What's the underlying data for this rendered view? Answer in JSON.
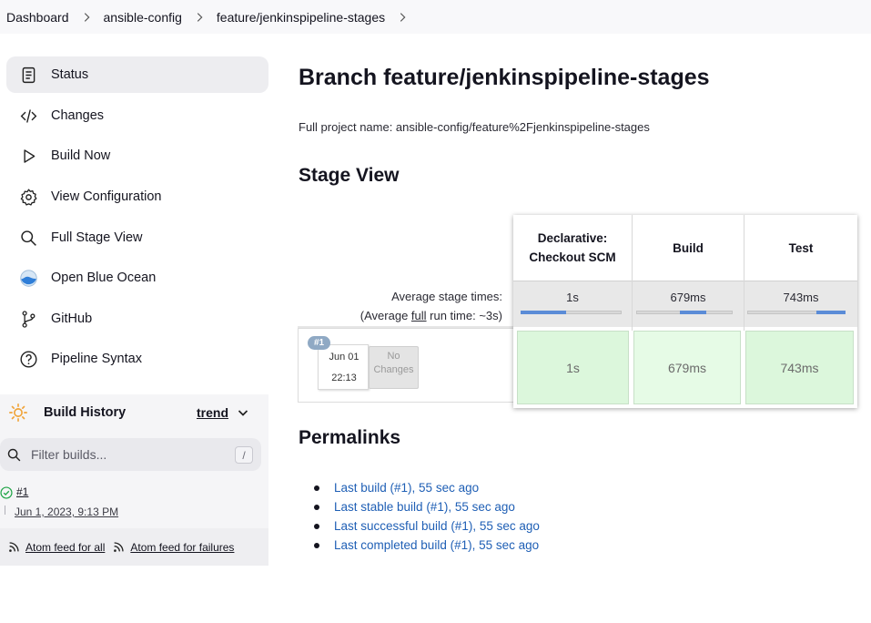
{
  "breadcrumb": [
    "Dashboard",
    "ansible-config",
    "feature/jenkinspipeline-stages"
  ],
  "sidebar": {
    "tasks": [
      {
        "label": "Status",
        "icon": "document-icon",
        "active": true
      },
      {
        "label": "Changes",
        "icon": "code-icon",
        "active": false
      },
      {
        "label": "Build Now",
        "icon": "play-icon",
        "active": false
      },
      {
        "label": "View Configuration",
        "icon": "gear-icon",
        "active": false
      },
      {
        "label": "Full Stage View",
        "icon": "search-icon",
        "active": false
      },
      {
        "label": "Open Blue Ocean",
        "icon": "blue-ocean-icon",
        "active": false
      },
      {
        "label": "GitHub",
        "icon": "git-branch-icon",
        "active": false
      },
      {
        "label": "Pipeline Syntax",
        "icon": "help-icon",
        "active": false
      }
    ]
  },
  "build_history": {
    "title": "Build History",
    "trend_label": "trend",
    "filter_placeholder": "Filter builds...",
    "filter_shortcut": "/",
    "builds": [
      {
        "number": "#1",
        "date": "Jun 1, 2023, 9:13 PM",
        "status": "success"
      }
    ],
    "feed_all": "Atom feed for all",
    "feed_failures": "Atom feed for failures"
  },
  "main": {
    "title": "Branch feature/jenkinspipeline-stages",
    "full_name": "Full project name: ansible-config/feature%2Fjenkinspipeline-stages",
    "stage_view_title": "Stage View",
    "permalinks_title": "Permalinks"
  },
  "stage_view": {
    "avg_label": "Average stage times:",
    "avg_run_prefix": "(Average ",
    "avg_run_link": "full",
    "avg_run_suffix": " run time: ~3s)",
    "stages": [
      {
        "name_line1": "Declarative:",
        "name_line2": "Checkout SCM",
        "avg": "1s",
        "bar_start": 0.0,
        "bar_fraction": 0.45
      },
      {
        "name_line1": "Build",
        "name_line2": "",
        "avg": "679ms",
        "bar_start": 0.45,
        "bar_fraction": 0.28
      },
      {
        "name_line1": "Test",
        "name_line2": "",
        "avg": "743ms",
        "bar_start": 0.7,
        "bar_fraction": 0.3
      }
    ],
    "run": {
      "badge": "#1",
      "date": "Jun 01",
      "time": "22:13",
      "changes": "No Changes",
      "cells": [
        "1s",
        "679ms",
        "743ms"
      ]
    },
    "colors": {
      "success_cell": "#dcf7dc",
      "success_cell_light": "#e6fbe6",
      "bar": "#5b8cd7"
    }
  },
  "permalinks": [
    "Last build (#1), 55 sec ago",
    "Last stable build (#1), 55 sec ago",
    "Last successful build (#1), 55 sec ago",
    "Last completed build (#1), 55 sec ago"
  ]
}
